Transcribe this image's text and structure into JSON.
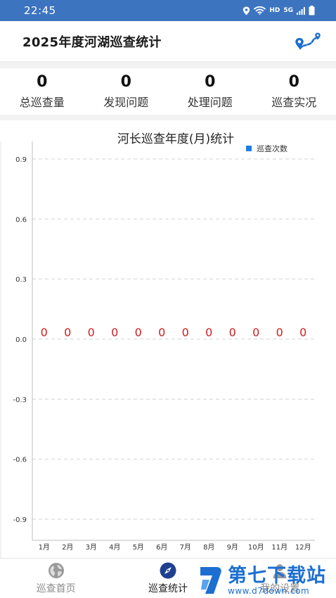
{
  "status_bar": {
    "time": "22:45",
    "network_badge": "HD",
    "signal_badge": "5G"
  },
  "header": {
    "title": "2025年度河湖巡查统计"
  },
  "stats": [
    {
      "value": "0",
      "label": "总巡查量"
    },
    {
      "value": "0",
      "label": "发现问题"
    },
    {
      "value": "0",
      "label": "处理问题"
    },
    {
      "value": "0",
      "label": "巡查实况"
    }
  ],
  "chart_data": {
    "type": "bar",
    "title": "河长巡查年度(月)统计",
    "categories": [
      "1月",
      "2月",
      "3月",
      "4月",
      "5月",
      "6月",
      "7月",
      "8月",
      "9月",
      "10月",
      "11月",
      "12月"
    ],
    "series": [
      {
        "name": "巡查次数",
        "values": [
          0,
          0,
          0,
          0,
          0,
          0,
          0,
          0,
          0,
          0,
          0,
          0
        ],
        "color": "#1e7ee0"
      }
    ],
    "yticks": [
      0.9,
      0.6,
      0.3,
      0.0,
      -0.3,
      -0.6,
      -0.9
    ],
    "ytick_labels": [
      "0.9",
      "0.6",
      "0.3",
      "0.0",
      "-0.3",
      "-0.6",
      "-0.9"
    ],
    "ylim": [
      -1.0,
      1.0
    ],
    "grid": true,
    "legend_position": "top-right",
    "value_label_color": "#cc1f1f"
  },
  "bottom_nav": [
    {
      "label": "巡查首页",
      "icon": "globe-icon",
      "active": false
    },
    {
      "label": "巡查统计",
      "icon": "compass-icon",
      "active": true
    },
    {
      "label": "我的设置",
      "icon": "user-icon",
      "active": false
    }
  ],
  "watermark": {
    "big": "第七下载站",
    "small": "www.d7down.com"
  },
  "colors": {
    "status_bar": "#3c74c0",
    "accent": "#1e7ee0",
    "map_icon": "#1c6fd1"
  }
}
